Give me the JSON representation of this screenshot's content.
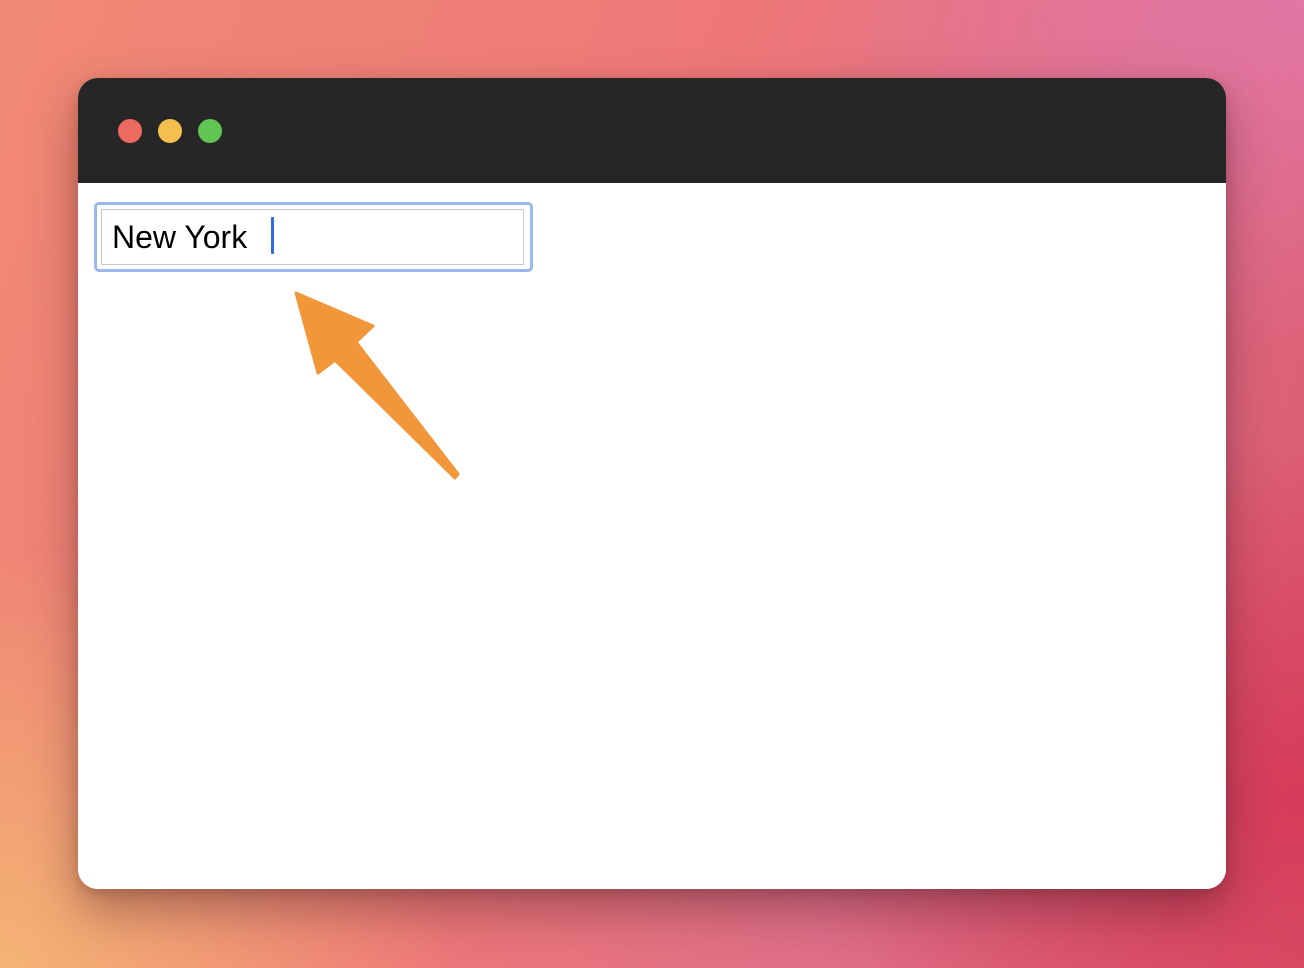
{
  "window": {
    "controls": [
      {
        "name": "close-button",
        "icon": "red-circle",
        "color": "#ec6a5e"
      },
      {
        "name": "minimize-button",
        "icon": "yellow-circle",
        "color": "#f4bf4f"
      },
      {
        "name": "maximize-button",
        "icon": "green-circle",
        "color": "#61c554"
      }
    ]
  },
  "form": {
    "city_input": {
      "value": "New York",
      "caret_color": "#2f6fe0",
      "focus_ring_color": "#9ab7ee"
    }
  },
  "annotation": {
    "icon": "arrow-pointer-icon",
    "color": "#f2963a"
  }
}
